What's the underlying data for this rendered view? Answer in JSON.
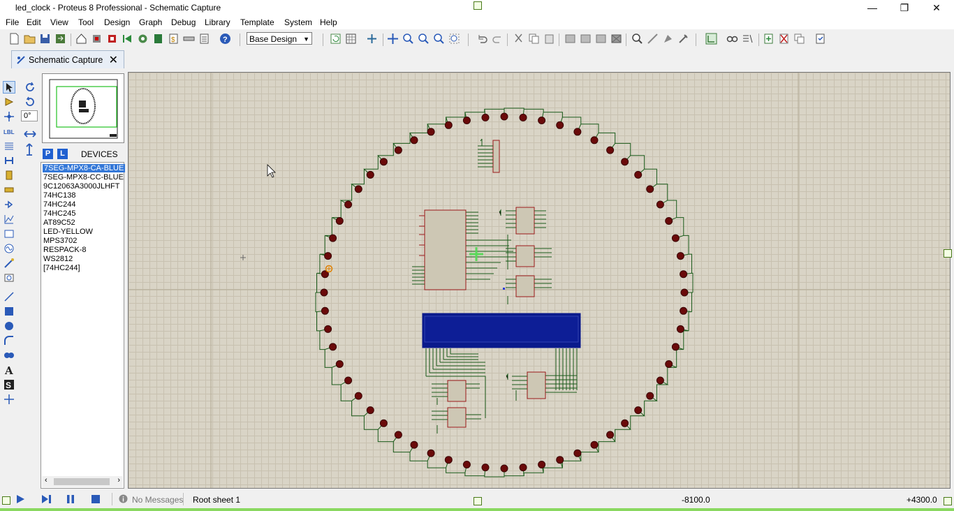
{
  "window": {
    "title": "led_clock - Proteus 8 Professional - Schematic Capture"
  },
  "menu": [
    "File",
    "Edit",
    "View",
    "Tool",
    "Design",
    "Graph",
    "Debug",
    "Library",
    "Template",
    "System",
    "Help"
  ],
  "toolbar": {
    "variant_select": "Base Design"
  },
  "tab": {
    "label": "Schematic Capture"
  },
  "rotation": {
    "angle": "0°"
  },
  "picker": {
    "p_label": "P",
    "l_label": "L",
    "header": "DEVICES"
  },
  "devices": [
    "7SEG-MPX8-CA-BLUE",
    "7SEG-MPX8-CC-BLUE",
    "9C12063A3000JLHFT",
    "74HC138",
    "74HC244",
    "74HC245",
    "AT89C52",
    "LED-YELLOW",
    "MPS3702",
    "RESPACK-8",
    "WS2812",
    "[74HC244]"
  ],
  "selected_device": "7SEG-MPX8-CA-BLUE",
  "status": {
    "messages": "No Messages",
    "sheet": "Root sheet 1",
    "x_coord": "-8100.0",
    "y_coord": "+4300.0"
  },
  "colors": {
    "accent": "#3478d8",
    "led": "#6a0a0a",
    "wire": "#1a5a1a",
    "ic_fill": "#cdc7b4",
    "ic_border": "#9a1a1a",
    "lcd": "#0a1a8c",
    "canvas_bg": "#d9d4c6"
  }
}
